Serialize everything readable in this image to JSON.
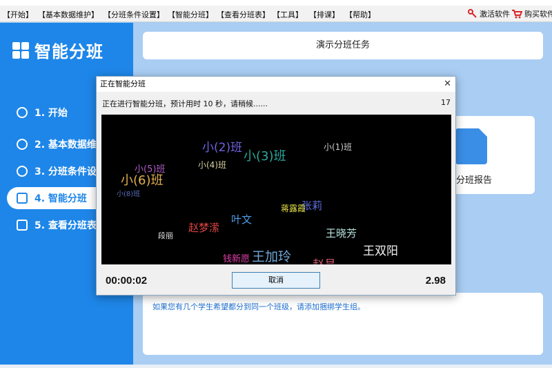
{
  "menu": {
    "items": [
      "【开始】",
      "【基本数据维护】",
      "【分班条件设置】",
      "【智能分班】",
      "【查看分班表】",
      "【工具】",
      "【排课】",
      "【帮助】"
    ],
    "activate_label": "激活软件",
    "buy_label": "购买软件"
  },
  "sidebar": {
    "logo_text": "智能分班",
    "items": [
      {
        "label": "1. 开始"
      },
      {
        "label": "2. 基本数据维"
      },
      {
        "label": "3. 分班条件设"
      },
      {
        "label": "4. 智能分班"
      },
      {
        "label": "5. 查看分班表"
      }
    ],
    "active_index": 3
  },
  "main": {
    "header_title": "演示分班任务",
    "report_label": "能分班报告",
    "tip_text": "如果您有几个学生希望都分到同一个班级，请添加捆绑学生组。"
  },
  "dialog": {
    "title": "正在智能分班",
    "close_glyph": "✕",
    "status": "正在进行智能分班，预计用时 10 秒，请稍候......",
    "count": "17",
    "timer": "00:00:02",
    "cancel_label": "取消",
    "value": "2.98",
    "words": [
      {
        "text": "小(2)班",
        "color": "#6f63e0"
      },
      {
        "text": "小(3)班",
        "color": "#2aa79a"
      },
      {
        "text": "小(1)班",
        "color": "#cfcfcf"
      },
      {
        "text": "小(5)班",
        "color": "#b05cc8"
      },
      {
        "text": "小(4)班",
        "color": "#d8d2a0"
      },
      {
        "text": "小(6)班",
        "color": "#e2b04e"
      },
      {
        "text": "小(8)班",
        "color": "#5a6fbf"
      },
      {
        "text": "张莉",
        "color": "#5d6fe2"
      },
      {
        "text": "蒋露霞",
        "color": "#e8e24a"
      },
      {
        "text": "叶文",
        "color": "#4f9ee8"
      },
      {
        "text": "赵梦潆",
        "color": "#e04545"
      },
      {
        "text": "王晓芳",
        "color": "#b9e6e0"
      },
      {
        "text": "段丽",
        "color": "#e8e8e8"
      },
      {
        "text": "王双阳",
        "color": "#f0f0f0"
      },
      {
        "text": "钱新愿",
        "color": "#e23fae"
      },
      {
        "text": "王加玲",
        "color": "#6fa7d8"
      },
      {
        "text": "赵昌",
        "color": "#d05a6e"
      }
    ]
  },
  "colors": {
    "sidebar_bg": "#1e86e8",
    "content_bg": "#a9cdf3",
    "canvas_bg": "#000000"
  }
}
